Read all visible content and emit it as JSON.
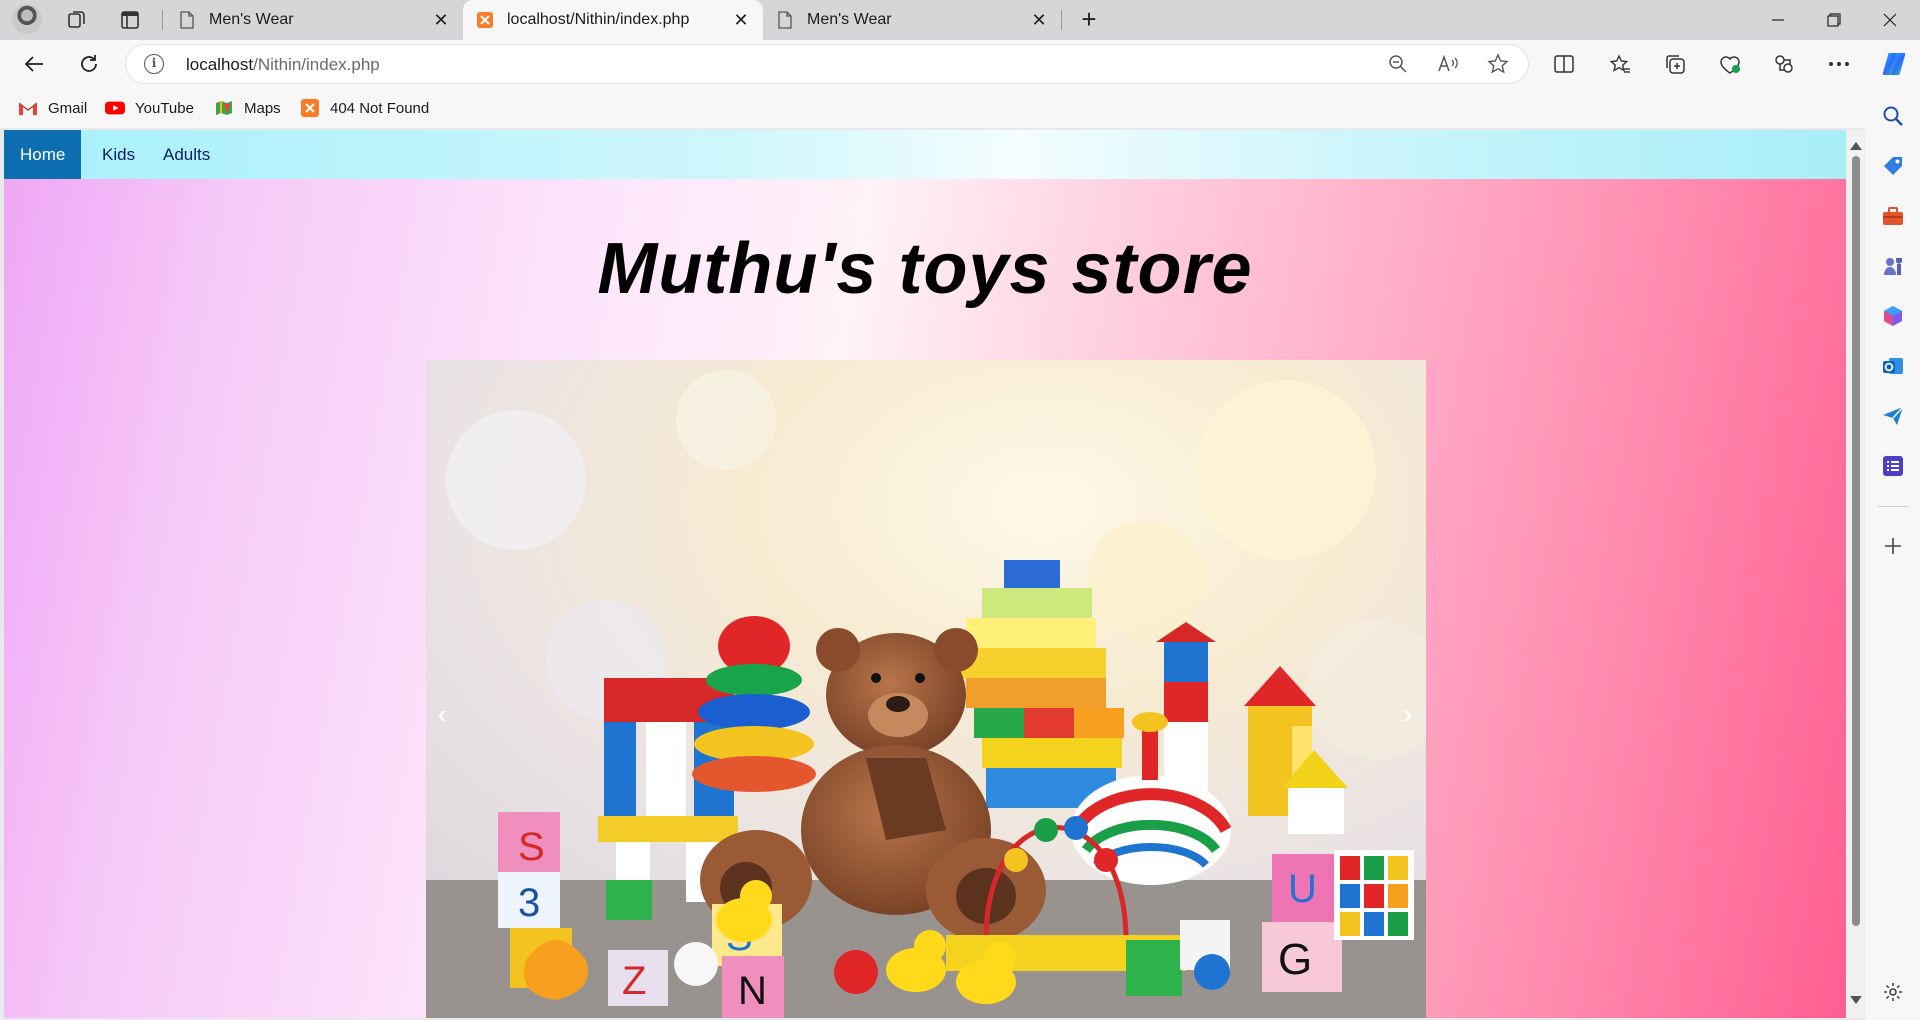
{
  "browser": {
    "tabs": [
      {
        "title": "Men's Wear",
        "favicon": "page-icon",
        "active": false
      },
      {
        "title": "localhost/Nithin/index.php",
        "favicon": "xampp-icon",
        "active": true
      },
      {
        "title": "Men's Wear",
        "favicon": "page-icon",
        "active": false
      }
    ],
    "address_bar": {
      "host": "localhost",
      "path": "/Nithin/index.php"
    },
    "bookmarks": [
      {
        "label": "Gmail",
        "icon": "gmail-icon"
      },
      {
        "label": "YouTube",
        "icon": "youtube-icon"
      },
      {
        "label": "Maps",
        "icon": "maps-icon"
      },
      {
        "label": "404 Not Found",
        "icon": "xampp-icon"
      }
    ]
  },
  "page": {
    "nav": [
      {
        "label": "Home",
        "active": true
      },
      {
        "label": "Kids",
        "active": false
      },
      {
        "label": "Adults",
        "active": false
      }
    ],
    "title": "Muthu's toys store",
    "carousel": {
      "prev_glyph": "‹",
      "next_glyph": "›",
      "image": "toys-photo"
    }
  },
  "colors": {
    "nav_active": "#0d6eb1",
    "nav_text": "#0e1e63",
    "accent_pink": "#ff5f92",
    "accent_lilac": "#eea6f4"
  }
}
